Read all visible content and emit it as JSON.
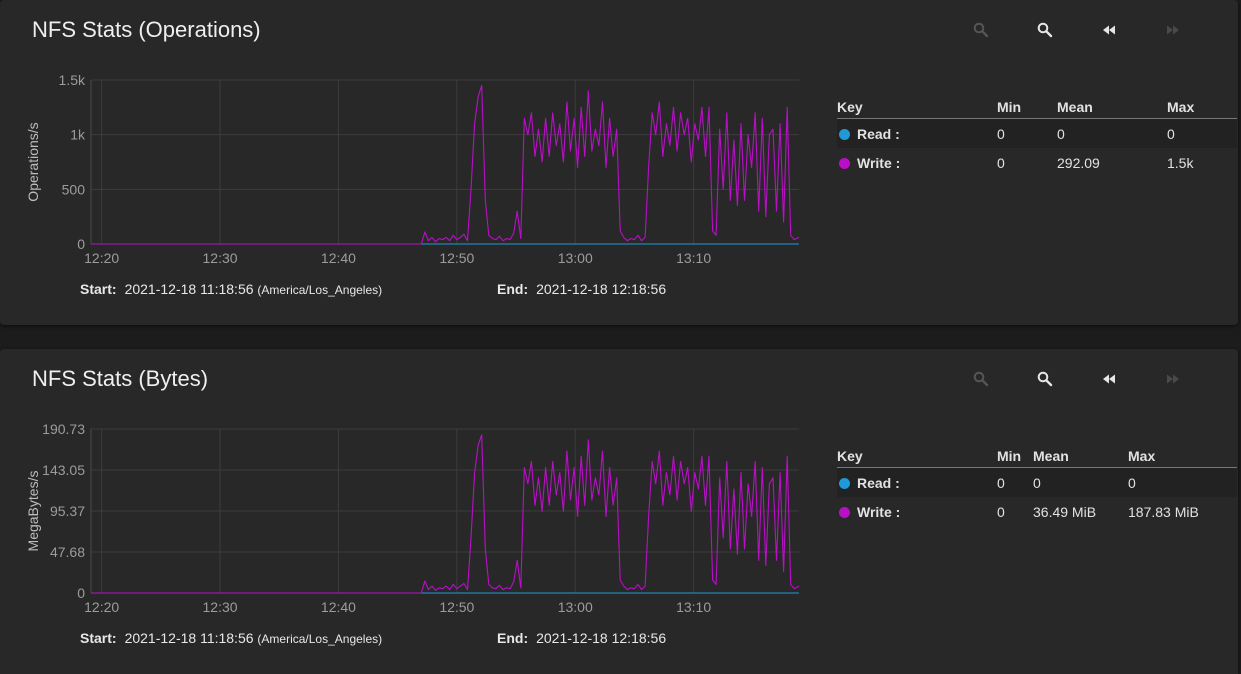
{
  "colors": {
    "read": "#1f9ad6",
    "write": "#b90fc7",
    "grid": "#3c3c3c",
    "axis_text": "#9c9c9c"
  },
  "icons": {
    "zoom_in": "zoom-in-icon",
    "zoom_out": "zoom-out-icon",
    "rewind": "rewind-icon",
    "fast_forward": "fast-forward-icon"
  },
  "panels": [
    {
      "title": "NFS Stats (Operations)",
      "start_label": "Start:",
      "start_value": "2021-12-18 11:18:56",
      "start_tz": "(America/Los_Angeles)",
      "end_label": "End:",
      "end_value": "2021-12-18 12:18:56",
      "legend": {
        "headers": [
          "Key",
          "Min",
          "Mean",
          "Max"
        ],
        "rows": [
          {
            "name": "Read :",
            "min": "0",
            "mean": "0",
            "max": "0"
          },
          {
            "name": "Write :",
            "min": "0",
            "mean": "292.09",
            "max": "1.5k"
          }
        ]
      }
    },
    {
      "title": "NFS Stats (Bytes)",
      "start_label": "Start:",
      "start_value": "2021-12-18 11:18:56",
      "start_tz": "(America/Los_Angeles)",
      "end_label": "End:",
      "end_value": "2021-12-18 12:18:56",
      "legend": {
        "headers": [
          "Key",
          "Min",
          "Mean",
          "Max"
        ],
        "rows": [
          {
            "name": "Read :",
            "min": "0",
            "mean": "0",
            "max": "0"
          },
          {
            "name": "Write :",
            "min": "0",
            "mean": "36.49 MiB",
            "max": "187.83 MiB"
          }
        ]
      }
    }
  ],
  "chart_data": [
    {
      "type": "line",
      "ylabel": "Operations/s",
      "x_ticks": [
        "12:20",
        "12:30",
        "12:40",
        "12:50",
        "13:00",
        "13:10"
      ],
      "x_tick_minutes": [
        740,
        750,
        760,
        770,
        780,
        790
      ],
      "xlim_minutes": [
        739.1,
        798.9
      ],
      "y_ticks": [
        0,
        500,
        1000,
        1500
      ],
      "y_tick_labels": [
        "0",
        "500",
        "1k",
        "1.5k"
      ],
      "ylim": [
        0,
        1500
      ],
      "grid": true,
      "series": [
        {
          "name": "Read",
          "x_minutes": [
            739.1,
            798.9
          ],
          "values": [
            0,
            0
          ]
        },
        {
          "name": "Write",
          "x_minutes": [
            739.1,
            767.0,
            767.3,
            767.6,
            767.9,
            768.2,
            768.5,
            768.8,
            769.1,
            769.4,
            769.7,
            770.0,
            770.3,
            770.6,
            770.9,
            771.2,
            771.5,
            771.8,
            772.1,
            772.4,
            772.7,
            773.0,
            773.3,
            773.6,
            773.9,
            774.2,
            774.5,
            774.8,
            775.1,
            775.4,
            775.7,
            776.0,
            776.3,
            776.6,
            776.9,
            777.2,
            777.5,
            777.8,
            778.1,
            778.4,
            778.7,
            779.0,
            779.3,
            779.6,
            779.9,
            780.2,
            780.5,
            780.8,
            781.1,
            781.4,
            781.7,
            782.0,
            782.3,
            782.6,
            782.9,
            783.2,
            783.5,
            783.8,
            784.1,
            784.4,
            784.7,
            785.0,
            785.3,
            785.6,
            785.9,
            786.2,
            786.5,
            786.8,
            787.1,
            787.4,
            787.7,
            788.0,
            788.3,
            788.6,
            788.9,
            789.2,
            789.5,
            789.8,
            790.1,
            790.4,
            790.7,
            791.0,
            791.3,
            791.6,
            791.9,
            792.2,
            792.5,
            792.8,
            793.1,
            793.4,
            793.7,
            794.0,
            794.3,
            794.6,
            794.9,
            795.2,
            795.5,
            795.8,
            796.1,
            796.4,
            796.7,
            797.0,
            797.3,
            797.6,
            797.9,
            798.2,
            798.5,
            798.9
          ],
          "values": [
            0,
            0,
            110,
            30,
            60,
            20,
            50,
            40,
            60,
            30,
            80,
            40,
            60,
            90,
            30,
            500,
            1100,
            1350,
            1450,
            400,
            80,
            50,
            40,
            70,
            30,
            50,
            40,
            100,
            300,
            50,
            1150,
            1000,
            1200,
            800,
            1050,
            750,
            1150,
            800,
            1200,
            900,
            1100,
            750,
            1300,
            850,
            1150,
            700,
            1250,
            800,
            1400,
            850,
            1050,
            900,
            1300,
            700,
            1150,
            800,
            1050,
            120,
            60,
            30,
            50,
            40,
            80,
            30,
            60,
            700,
            1200,
            1000,
            1300,
            800,
            1100,
            900,
            1250,
            850,
            1200,
            1000,
            1150,
            750,
            1100,
            950,
            1250,
            800,
            1250,
            120,
            80,
            1050,
            500,
            1200,
            400,
            950,
            350,
            1100,
            400,
            1000,
            700,
            1200,
            300,
            1150,
            250,
            1000,
            1050,
            300,
            1100,
            200,
            1250,
            80,
            40,
            60
          ]
        }
      ]
    },
    {
      "type": "line",
      "ylabel": "MegaBytes/s",
      "x_ticks": [
        "12:20",
        "12:30",
        "12:40",
        "12:50",
        "13:00",
        "13:10"
      ],
      "x_tick_minutes": [
        740,
        750,
        760,
        770,
        780,
        790
      ],
      "xlim_minutes": [
        739.1,
        798.9
      ],
      "y_ticks": [
        0,
        47.68,
        95.37,
        143.05,
        190.73
      ],
      "y_tick_labels": [
        "0",
        "47.68",
        "95.37",
        "143.05",
        "190.73"
      ],
      "ylim": [
        0,
        190.73
      ],
      "grid": true,
      "series": [
        {
          "name": "Read",
          "x_minutes": [
            739.1,
            798.9
          ],
          "values": [
            0,
            0
          ]
        },
        {
          "name": "Write",
          "x_minutes": [
            739.1,
            767.0,
            767.3,
            767.6,
            767.9,
            768.2,
            768.5,
            768.8,
            769.1,
            769.4,
            769.7,
            770.0,
            770.3,
            770.6,
            770.9,
            771.2,
            771.5,
            771.8,
            772.1,
            772.4,
            772.7,
            773.0,
            773.3,
            773.6,
            773.9,
            774.2,
            774.5,
            774.8,
            775.1,
            775.4,
            775.7,
            776.0,
            776.3,
            776.6,
            776.9,
            777.2,
            777.5,
            777.8,
            778.1,
            778.4,
            778.7,
            779.0,
            779.3,
            779.6,
            779.9,
            780.2,
            780.5,
            780.8,
            781.1,
            781.4,
            781.7,
            782.0,
            782.3,
            782.6,
            782.9,
            783.2,
            783.5,
            783.8,
            784.1,
            784.4,
            784.7,
            785.0,
            785.3,
            785.6,
            785.9,
            786.2,
            786.5,
            786.8,
            787.1,
            787.4,
            787.7,
            788.0,
            788.3,
            788.6,
            788.9,
            789.2,
            789.5,
            789.8,
            790.1,
            790.4,
            790.7,
            791.0,
            791.3,
            791.6,
            791.9,
            792.2,
            792.5,
            792.8,
            793.1,
            793.4,
            793.7,
            794.0,
            794.3,
            794.6,
            794.9,
            795.2,
            795.5,
            795.8,
            796.1,
            796.4,
            796.7,
            797.0,
            797.3,
            797.6,
            797.9,
            798.2,
            798.5,
            798.9
          ],
          "values": [
            0,
            0,
            14,
            4,
            8,
            3,
            6,
            5,
            8,
            4,
            10,
            5,
            8,
            11,
            4,
            64,
            140,
            172,
            184,
            51,
            10,
            6,
            5,
            9,
            4,
            6,
            5,
            13,
            38,
            6,
            146,
            127,
            153,
            102,
            134,
            95,
            146,
            102,
            153,
            114,
            140,
            95,
            165,
            108,
            146,
            89,
            159,
            102,
            178,
            108,
            134,
            114,
            165,
            89,
            146,
            102,
            134,
            15,
            8,
            4,
            6,
            5,
            10,
            4,
            8,
            89,
            153,
            127,
            165,
            102,
            140,
            114,
            159,
            108,
            153,
            127,
            146,
            95,
            140,
            121,
            159,
            102,
            159,
            15,
            10,
            134,
            64,
            153,
            51,
            121,
            45,
            140,
            51,
            127,
            89,
            153,
            38,
            146,
            32,
            127,
            134,
            38,
            140,
            25,
            159,
            10,
            5,
            8
          ]
        }
      ]
    }
  ]
}
